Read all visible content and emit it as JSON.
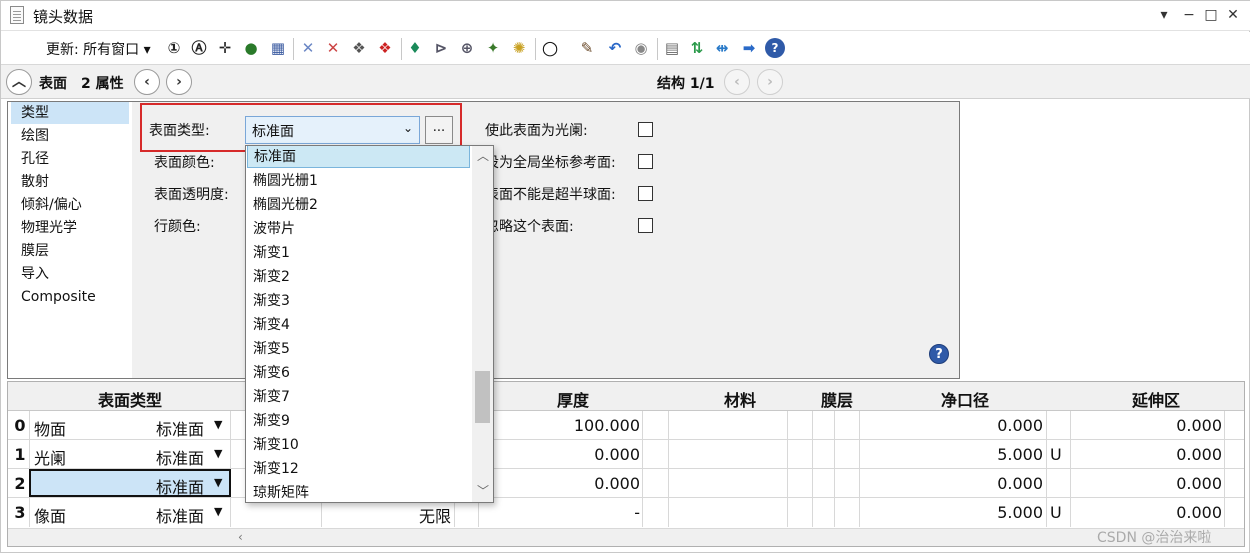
{
  "window": {
    "title": "镜头数据",
    "controls": [
      "▾",
      "−",
      "□",
      "✕"
    ]
  },
  "toolbar": {
    "update_label": "更新: 所有窗口 ▾"
  },
  "nav": {
    "surface_label": "表面",
    "surface_num": "2 属性",
    "config_label": "结构 1/1"
  },
  "categories": [
    "类型",
    "绘图",
    "孔径",
    "散射",
    "倾斜/偏心",
    "物理光学",
    "膜层",
    "导入",
    "Composite"
  ],
  "type_tab": {
    "surface_type_label": "表面类型:",
    "surface_type_value": "标准面",
    "dots": "...",
    "color_label": "表面颜色:",
    "opacity_label": "表面透明度:",
    "row_color_label": "行颜色:",
    "stop_label": "使此表面为光阑:",
    "global_ref_label": "设为全局坐标参考面:",
    "hyper_label": "表面不能是超半球面:",
    "ignore_label": "忽略这个表面:"
  },
  "dropdown_options": [
    "标准面",
    "椭圆光栅1",
    "椭圆光栅2",
    "波带片",
    "渐变1",
    "渐变2",
    "渐变3",
    "渐变4",
    "渐变5",
    "渐变6",
    "渐变7",
    "渐变9",
    "渐变10",
    "渐变12",
    "琼斯矩阵"
  ],
  "grid": {
    "headers": [
      "表面类型",
      "厚度",
      "材料",
      "膜层",
      "净口径",
      "延伸区"
    ],
    "rows": [
      {
        "num": "0",
        "name": "物面",
        "type": "标准面",
        "thickness": "100.000",
        "aperture": "0.000",
        "ap_flag": "",
        "ext": "0.000"
      },
      {
        "num": "1",
        "name": "光阑",
        "type": "标准面",
        "thickness": "0.000",
        "aperture": "5.000",
        "ap_flag": "U",
        "ext": "0.000"
      },
      {
        "num": "2",
        "name": "",
        "type": "标准面",
        "thickness": "0.000",
        "aperture": "0.000",
        "ap_flag": "",
        "ext": "0.000"
      },
      {
        "num": "3",
        "name": "像面",
        "type": "标准面",
        "radius": "无限",
        "thickness": "-",
        "aperture": "5.000",
        "ap_flag": "U",
        "ext": "0.000"
      }
    ]
  },
  "watermark": "CSDN @治治来啦"
}
